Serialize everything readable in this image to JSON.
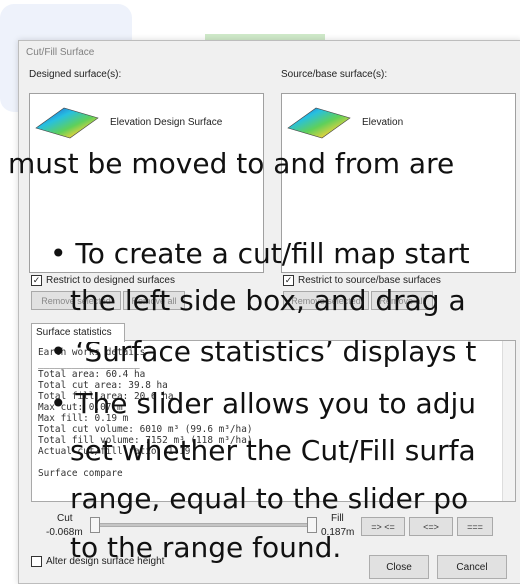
{
  "dialog": {
    "title": "Cut/Fill Surface",
    "designed_label": "Designed surface(s):",
    "source_label": "Source/base surface(s):",
    "designed_item": "Elevation Design Surface",
    "source_item": "Elevation",
    "restrict_designed": "Restrict to designed surfaces",
    "restrict_source": "Restrict to source/base surfaces",
    "remove_selected": "Remove selected",
    "remove_all": "Remove all",
    "tab_label": "Surface statistics",
    "stats_text": "Earth works details\n__________________\nTotal area: 60.4 ha\nTotal cut area: 39.8 ha\nTotal fill area: 20.6 ha\nMax cut: 0.07 m\nMax fill: 0.19 m\nTotal cut volume: 6010 m³ (99.6 m³/ha)\nTotal fill volume: 7152 m³ (118 m³/ha)\nActual cut/fill ratio: 1.19\n\nSurface compare",
    "cut_label": "Cut",
    "cut_value": "-0.068m",
    "fill_label": "Fill",
    "fill_value": "0.187m",
    "range_buttons": [
      "=> <=",
      "<=>",
      "==="
    ],
    "alter_height": "Alter design surface height",
    "close": "Close",
    "cancel": "Cancel"
  },
  "overlay": {
    "line1": "must be moved to and from are",
    "line2": "• To create a cut/fill map start",
    "line3": "the left side box, and drag a",
    "line4": "• ‘Surface statistics’ displays t",
    "line5": "• The slider allows you to adju",
    "line6": "set whether the Cut/Fill surfa",
    "line7": "range, equal to the slider po",
    "line8": "to the range found."
  }
}
